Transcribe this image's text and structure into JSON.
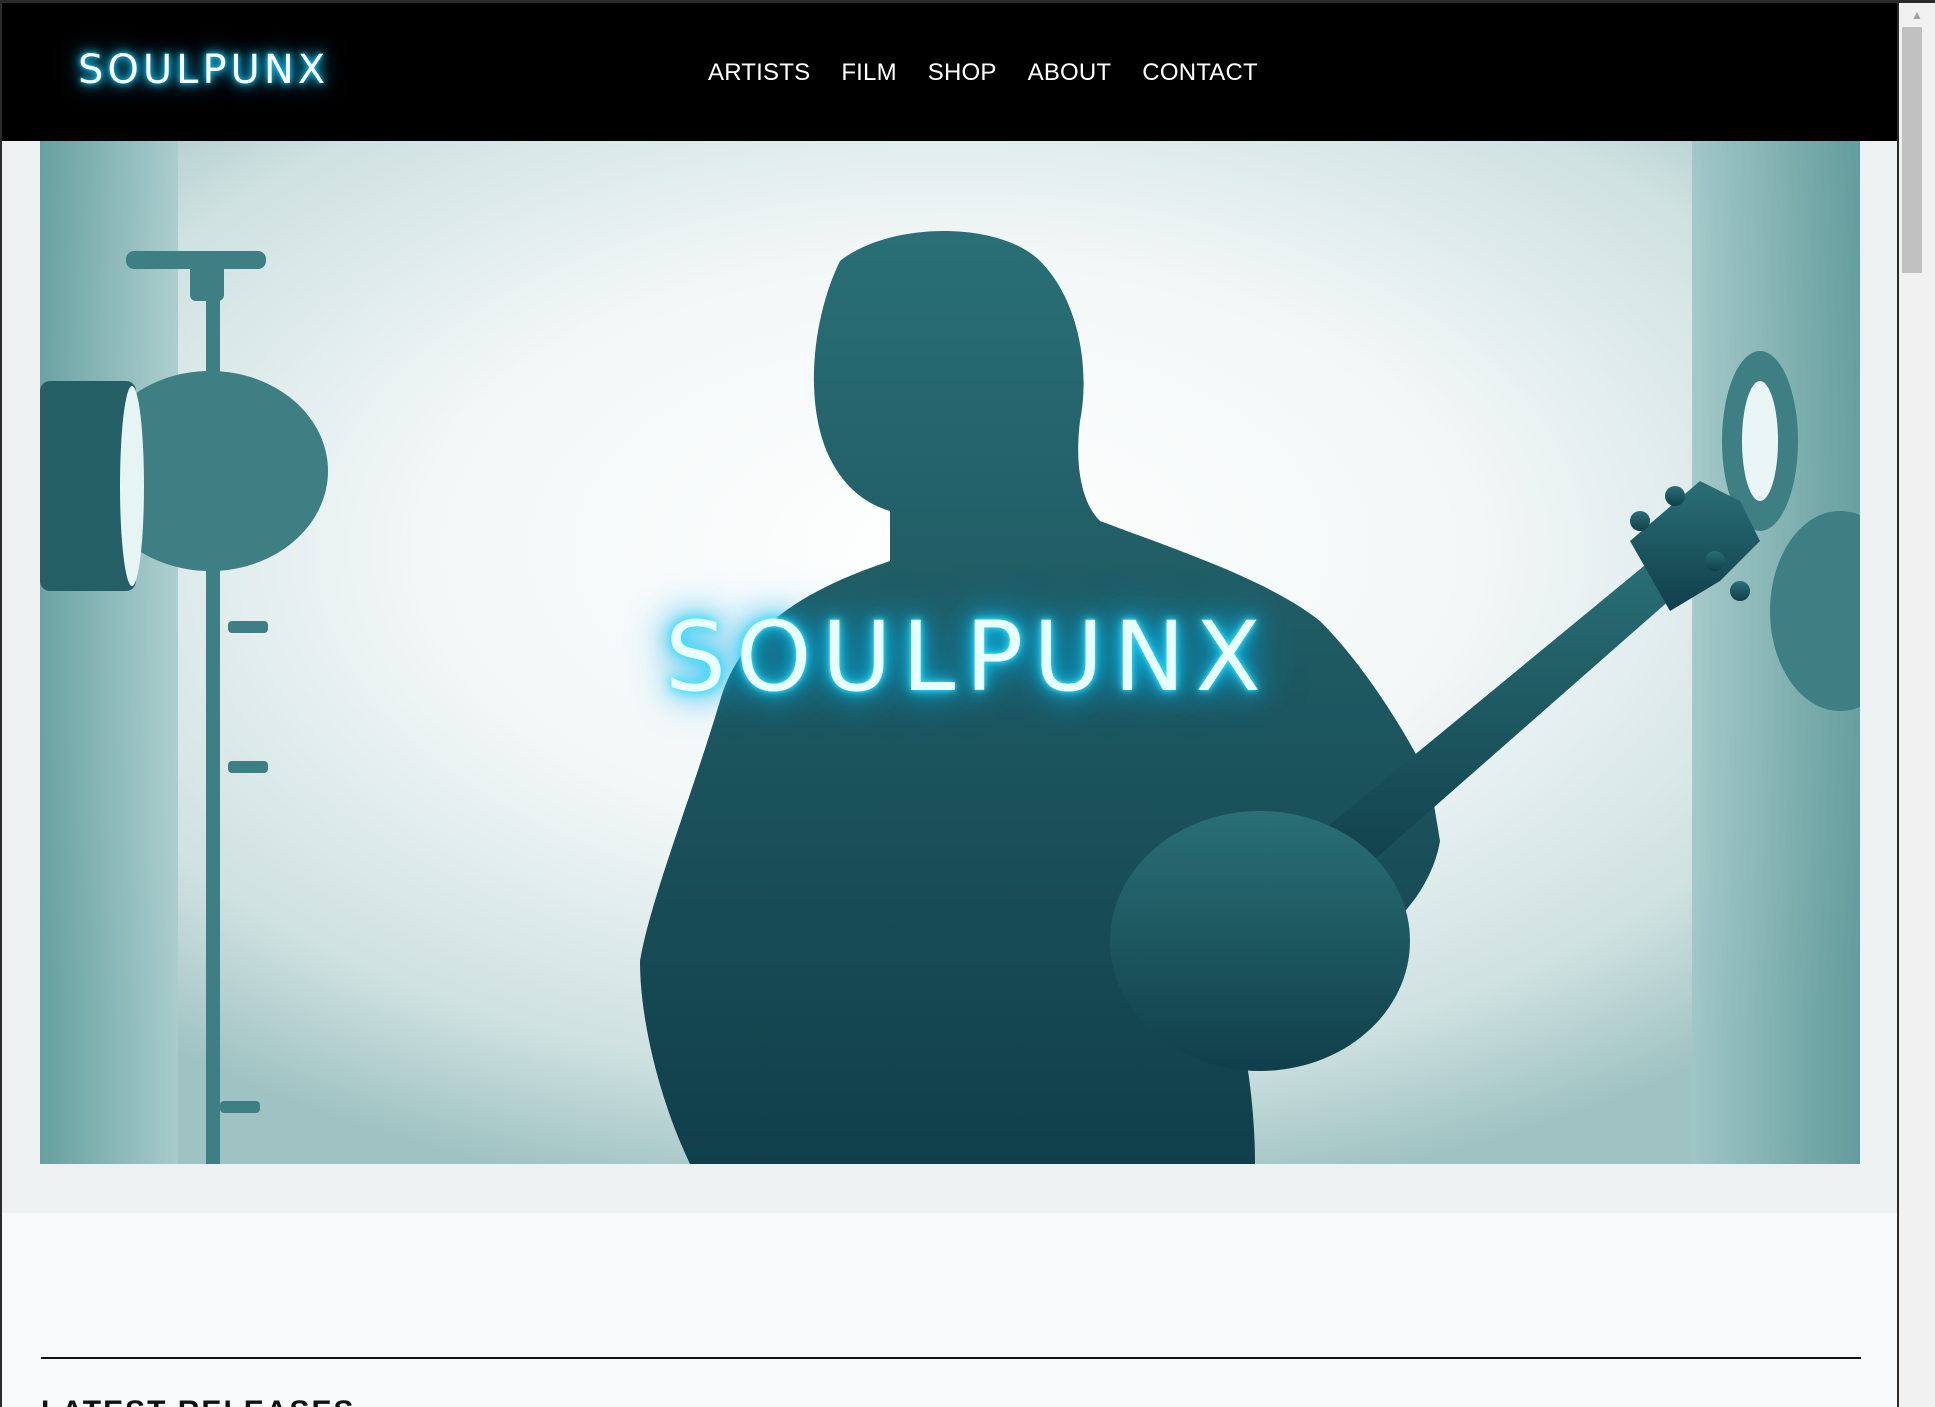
{
  "brand": {
    "logo_text": "SOULPUNX",
    "accent_glow": "#19d8ff"
  },
  "nav": {
    "items": [
      {
        "label": "ARTISTS"
      },
      {
        "label": "FILM"
      },
      {
        "label": "SHOP"
      },
      {
        "label": "ABOUT"
      },
      {
        "label": "CONTACT"
      }
    ]
  },
  "hero": {
    "title": "SOULPUNX",
    "image": "silhouette-guitarist-teal-studio"
  },
  "section": {
    "heading": "LATEST RELEASES"
  },
  "colors": {
    "header_bg": "#000000",
    "hero_teal": "#1f5e66",
    "page_bg": "#f8f9fa"
  }
}
